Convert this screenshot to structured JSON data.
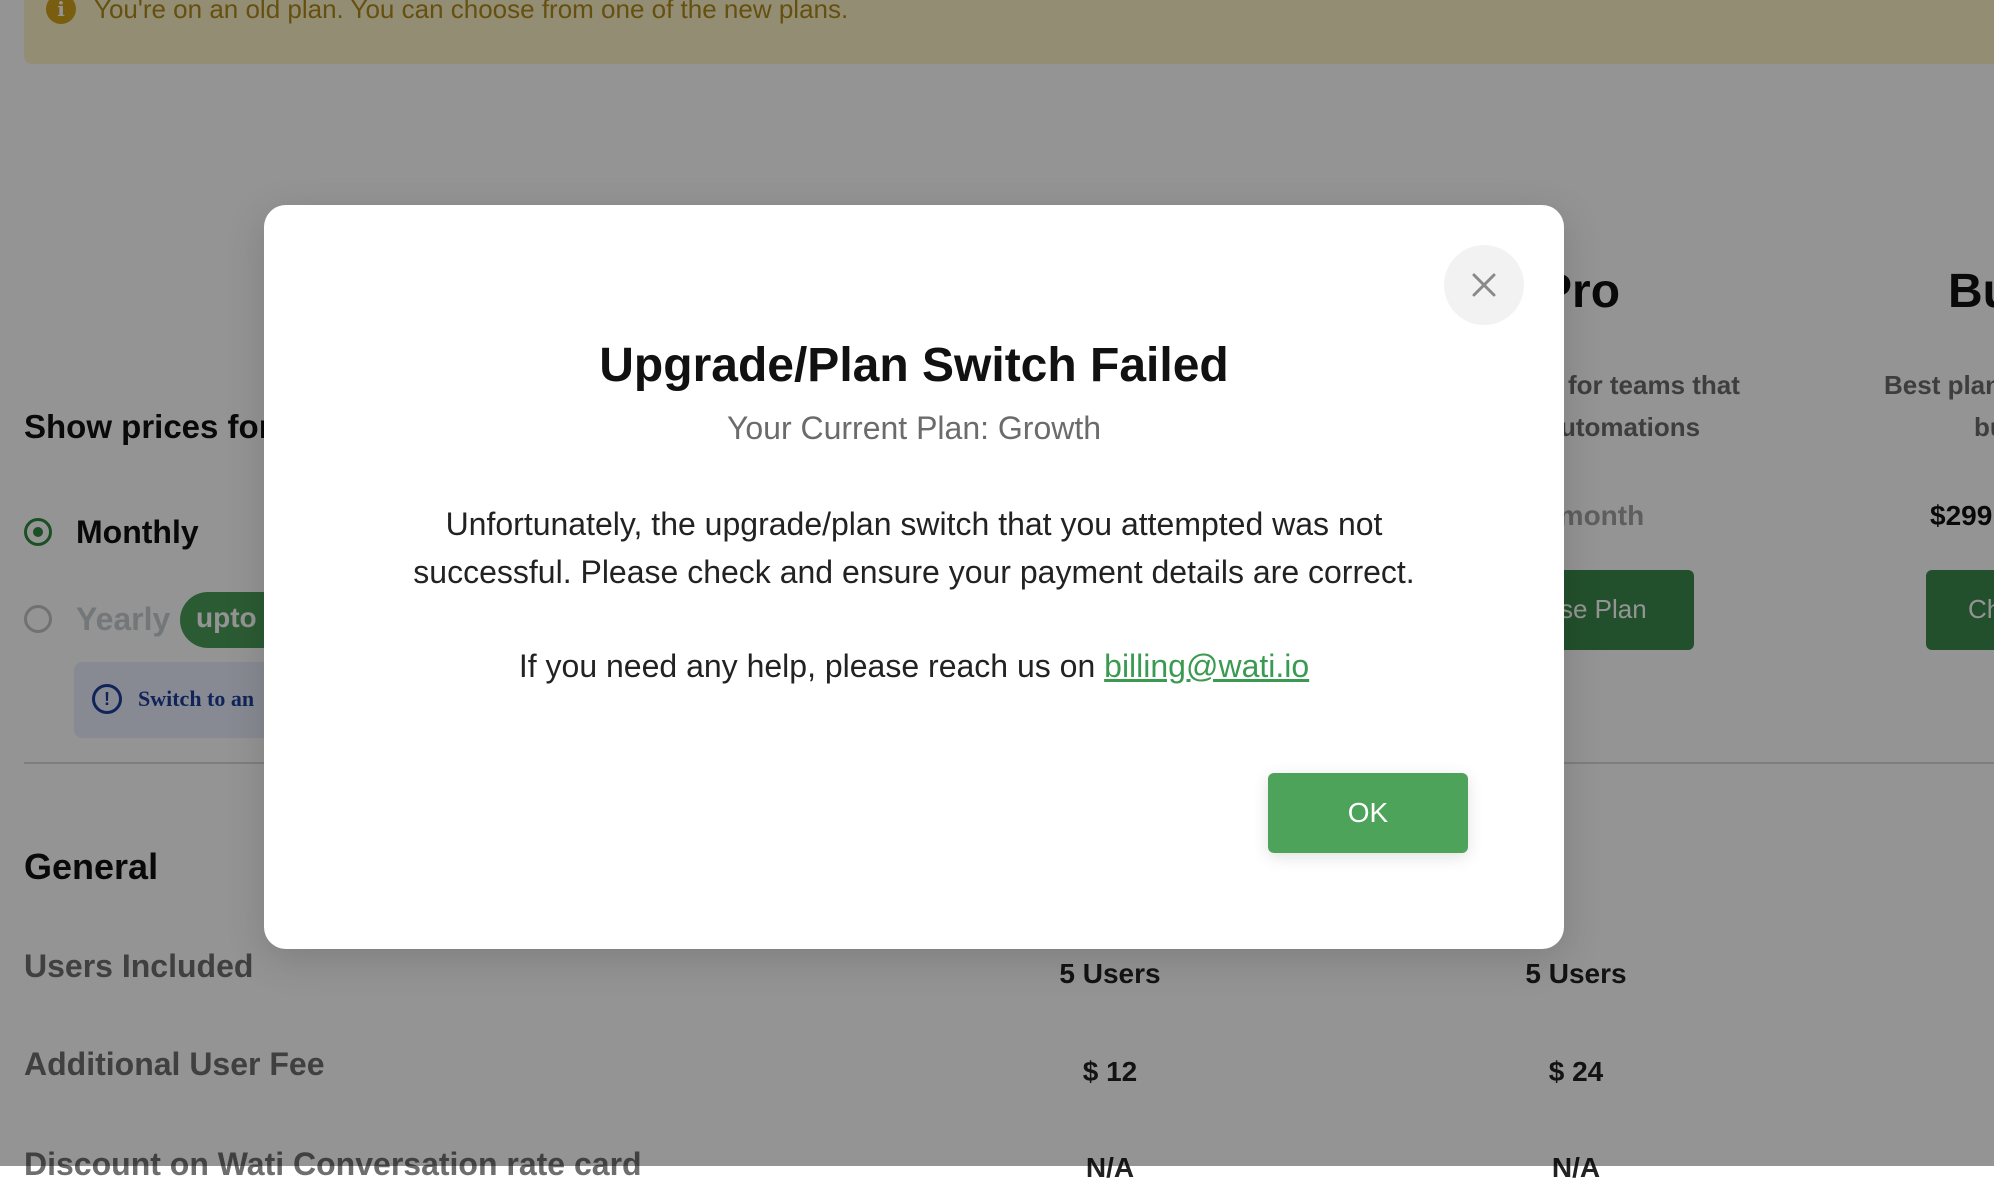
{
  "banner": {
    "text": "You're on an old plan. You can choose from one of the new plans."
  },
  "pricing": {
    "show_prices_label": "Show prices for",
    "monthly_label": "Monthly",
    "yearly_label": "Yearly",
    "yearly_badge": "upto",
    "switch_note": "Switch to an"
  },
  "plans": [
    {
      "name": "Pro",
      "desc_line1": "for teams that",
      "desc_line2": "utomations",
      "price": "r month",
      "button": "se Plan"
    },
    {
      "name": "Bu",
      "desc_line1": "Best plan",
      "desc_line2": "bu",
      "price": "$299",
      "button": "Ch"
    }
  ],
  "general": {
    "heading": "General",
    "rows": [
      {
        "label": "Users Included",
        "values": [
          "5 Users",
          "5 Users"
        ]
      },
      {
        "label": "Additional User Fee",
        "values": [
          "$ 12",
          "$ 24"
        ]
      },
      {
        "label": "Discount on Wati Conversation rate card",
        "values": [
          "N/A",
          "N/A"
        ]
      }
    ]
  },
  "modal": {
    "title": "Upgrade/Plan Switch Failed",
    "subtitle": "Your Current Plan: Growth",
    "body": "Unfortunately, the upgrade/plan switch that you attempted was not successful. Please check and ensure your payment details are correct.",
    "help_prefix": "If you need any help, please reach us on ",
    "help_email": "billing@wati.io",
    "ok_label": "OK",
    "close_icon": "close-icon"
  },
  "colors": {
    "accent": "#4ea35b",
    "banner_bg": "#fdf3c9",
    "overlay": "rgba(0,0,0,0.42)"
  }
}
